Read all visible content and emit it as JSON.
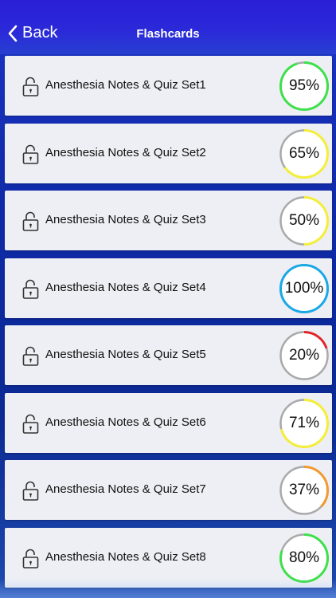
{
  "header": {
    "back_label": "Back",
    "title": "Flashcards"
  },
  "colors": {
    "green": "#3ee04a",
    "yellow": "#f4ee3a",
    "blue": "#1aa8e6",
    "red": "#e0262b",
    "orange": "#f2992f",
    "track": "#a9a9a9"
  },
  "items": [
    {
      "label": "Anesthesia Notes & Quiz Set1",
      "percent": "95%",
      "value": 95,
      "color": "green"
    },
    {
      "label": "Anesthesia Notes & Quiz Set2",
      "percent": "65%",
      "value": 65,
      "color": "yellow"
    },
    {
      "label": "Anesthesia Notes & Quiz Set3",
      "percent": "50%",
      "value": 50,
      "color": "yellow"
    },
    {
      "label": "Anesthesia Notes & Quiz Set4",
      "percent": "100%",
      "value": 100,
      "color": "blue"
    },
    {
      "label": "Anesthesia Notes & Quiz Set5",
      "percent": "20%",
      "value": 20,
      "color": "red"
    },
    {
      "label": "Anesthesia Notes & Quiz Set6",
      "percent": "71%",
      "value": 71,
      "color": "yellow"
    },
    {
      "label": "Anesthesia Notes & Quiz Set7",
      "percent": "37%",
      "value": 37,
      "color": "orange"
    },
    {
      "label": "Anesthesia Notes & Quiz Set8",
      "percent": "80%",
      "value": 80,
      "color": "green"
    }
  ]
}
